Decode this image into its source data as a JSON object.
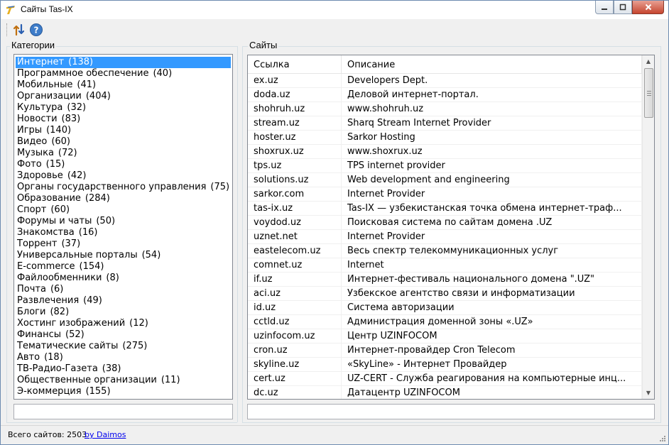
{
  "window": {
    "title": "Сайты Tas-IX"
  },
  "icons": {
    "app": "tasix-logo-icon",
    "sort": "sort-arrows-icon",
    "help": "help-question-icon"
  },
  "categories": {
    "label": "Категории",
    "items": [
      {
        "name": "Интернет",
        "count": "(138)"
      },
      {
        "name": "Программное обеспечение",
        "count": "(40)"
      },
      {
        "name": "Мобильные",
        "count": "(41)"
      },
      {
        "name": "Организации",
        "count": "(404)"
      },
      {
        "name": "Культура",
        "count": "(32)"
      },
      {
        "name": "Новости",
        "count": "(83)"
      },
      {
        "name": "Игры",
        "count": "(140)"
      },
      {
        "name": "Видео",
        "count": "(60)"
      },
      {
        "name": "Музыка",
        "count": "(72)"
      },
      {
        "name": "Фото",
        "count": "(15)"
      },
      {
        "name": "Здоровье",
        "count": "(42)"
      },
      {
        "name": "Органы государственного управления",
        "count": "(75)"
      },
      {
        "name": "Образование",
        "count": "(284)"
      },
      {
        "name": "Спорт",
        "count": "(60)"
      },
      {
        "name": "Форумы и чаты",
        "count": "(50)"
      },
      {
        "name": "Знакомства",
        "count": "(16)"
      },
      {
        "name": "Торрент",
        "count": "(37)"
      },
      {
        "name": "Универсальные порталы",
        "count": "(54)"
      },
      {
        "name": "E-commerce",
        "count": "(154)"
      },
      {
        "name": "Файлообменники",
        "count": "(8)"
      },
      {
        "name": "Почта",
        "count": "(6)"
      },
      {
        "name": "Развлечения",
        "count": "(49)"
      },
      {
        "name": "Блоги",
        "count": "(82)"
      },
      {
        "name": "Хостинг изображений",
        "count": "(12)"
      },
      {
        "name": "Финансы",
        "count": "(52)"
      },
      {
        "name": "Тематические сайты",
        "count": "(275)"
      },
      {
        "name": "Авто",
        "count": "(18)"
      },
      {
        "name": "ТВ-Радио-Газета",
        "count": "(38)"
      },
      {
        "name": "Общественные организации",
        "count": "(11)"
      },
      {
        "name": "Э-коммерция",
        "count": "(155)"
      }
    ],
    "selected_index": 0,
    "filter_value": ""
  },
  "sites": {
    "label": "Сайты",
    "columns": [
      "Ссылка",
      "Описание"
    ],
    "rows": [
      [
        "ex.uz",
        "Developers Dept."
      ],
      [
        "doda.uz",
        "Деловой интернет-портал."
      ],
      [
        "shohruh.uz",
        "www.shohruh.uz"
      ],
      [
        "stream.uz",
        "Sharq Stream Internet Provider"
      ],
      [
        "hoster.uz",
        "Sarkor Hosting"
      ],
      [
        "shoxrux.uz",
        "www.shoxrux.uz"
      ],
      [
        "tps.uz",
        "TPS internet provider"
      ],
      [
        "solutions.uz",
        "Web development and engineering"
      ],
      [
        "sarkor.com",
        "Internet Provider"
      ],
      [
        "tas-ix.uz",
        "Tas-IX — узбекистанская точка обмена интернет-траф..."
      ],
      [
        "voydod.uz",
        "Поисковая система по сайтам домена .UZ"
      ],
      [
        "uznet.net",
        "Internet Provider"
      ],
      [
        "eastelecom.uz",
        "Весь спектр телекоммуникационных услуг"
      ],
      [
        "comnet.uz",
        "Internet"
      ],
      [
        "if.uz",
        "Интернет-фестиваль национального домена \".UZ\""
      ],
      [
        "aci.uz",
        "Узбекское агентство связи и информатизации"
      ],
      [
        "id.uz",
        "Система авторизации"
      ],
      [
        "cctld.uz",
        "Администрация доменной зоны «.UZ»"
      ],
      [
        "uzinfocom.uz",
        "Центр UZINFOCOM"
      ],
      [
        "cron.uz",
        "Интернет-провайдер Cron Telecom"
      ],
      [
        "skyline.uz",
        "«SkyLine» - Интернет Провайдер"
      ],
      [
        "cert.uz",
        "UZ-CERT - Служба реагирования на компьютерные инц..."
      ],
      [
        "dc.uz",
        "Датацентр UZINFOCOM"
      ]
    ],
    "filter_value": ""
  },
  "status": {
    "total": "Всего сайтов: 2503",
    "link": "by Daimos"
  }
}
